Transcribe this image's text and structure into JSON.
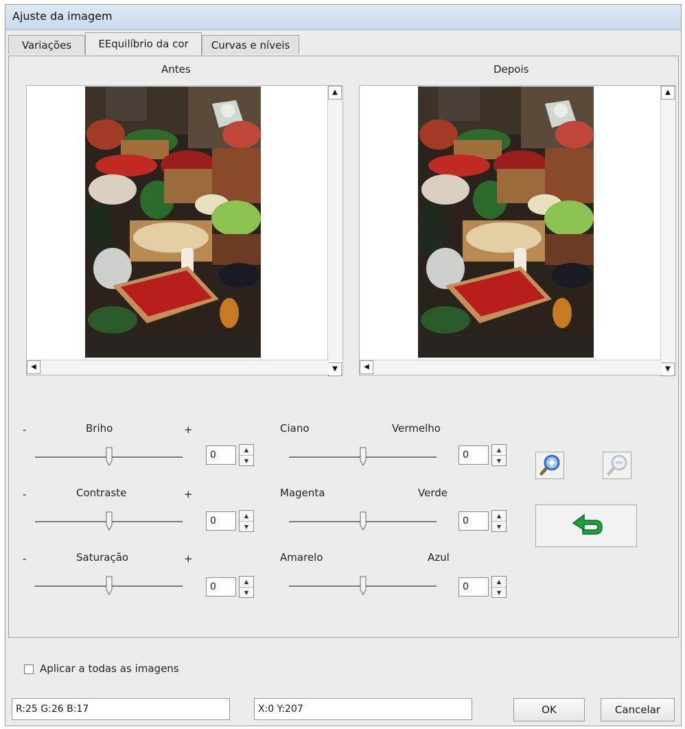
{
  "window": {
    "title": "Ajuste da imagem"
  },
  "tabs": [
    {
      "label": "Variações",
      "active": false
    },
    {
      "label": "EEquilíbrio da cor",
      "active": true
    },
    {
      "label": "Curvas e níveis",
      "active": false
    }
  ],
  "preview": {
    "before_label": "Antes",
    "after_label": "Depois"
  },
  "adjust": {
    "minus": "-",
    "plus": "+",
    "brightness": {
      "label": "Briho",
      "value": "0"
    },
    "contrast": {
      "label": "Contraste",
      "value": "0"
    },
    "saturation": {
      "label": "Saturação",
      "value": "0"
    },
    "cyan_red": {
      "left": "Ciano",
      "right": "Vermelho",
      "value": "0"
    },
    "magenta_green": {
      "left": "Magenta",
      "right": "Verde",
      "value": "0"
    },
    "yellow_blue": {
      "left": "Amarelo",
      "right": "Azul",
      "value": "0"
    }
  },
  "icons": {
    "zoom_in": "zoom-in-icon",
    "zoom_out": "zoom-out-icon",
    "reset": "undo-arrow-icon",
    "scroll_up": "arrow-up-icon",
    "scroll_down": "arrow-down-icon",
    "scroll_left": "arrow-left-icon"
  },
  "options": {
    "apply_all_label": "Aplicar a todas as imagens",
    "apply_all_checked": false
  },
  "status": {
    "rgb": "R:25 G:26 B:17",
    "coords": "X:0 Y:207"
  },
  "buttons": {
    "ok": "OK",
    "cancel": "Cancelar"
  },
  "colors": {
    "titlebar": "#c9d9eb",
    "reset_arrow": "#1aa33a",
    "zoom_lens": "#2f6fc8"
  }
}
